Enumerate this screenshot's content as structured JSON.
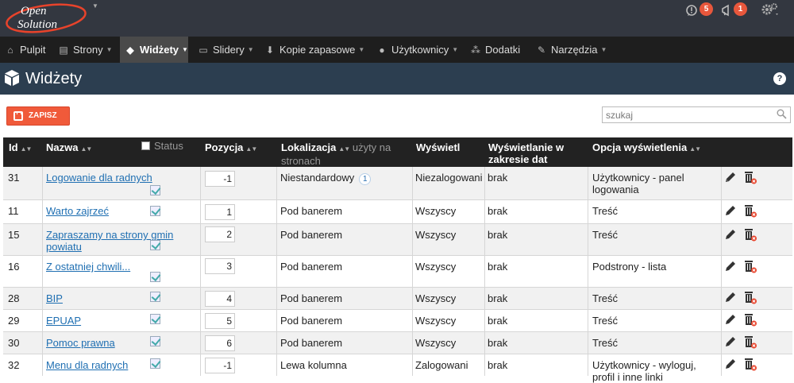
{
  "app": {
    "logo_line1": "Open",
    "logo_line2": "Solution",
    "notifications": {
      "messages": "5",
      "alerts": "1"
    }
  },
  "nav": {
    "items": [
      {
        "label": "Pulpit",
        "icon": "home-icon",
        "caret": false,
        "active": false
      },
      {
        "label": "Strony",
        "icon": "document-icon",
        "caret": true,
        "active": false
      },
      {
        "label": "Widżety",
        "icon": "cube-icon",
        "caret": true,
        "active": true
      },
      {
        "label": "Slidery",
        "icon": "slides-icon",
        "caret": true,
        "active": false
      },
      {
        "label": "Kopie zapasowe",
        "icon": "download-icon",
        "caret": true,
        "active": false
      },
      {
        "label": "Użytkownicy",
        "icon": "user-icon",
        "caret": true,
        "active": false
      },
      {
        "label": "Dodatki",
        "icon": "cubes-icon",
        "caret": false,
        "active": false
      },
      {
        "label": "Narzędzia",
        "icon": "wrench-icon",
        "caret": true,
        "active": false
      }
    ]
  },
  "page": {
    "title": "Widżety"
  },
  "toolbar": {
    "save_label": "ZAPISZ",
    "search_placeholder": "szukaj"
  },
  "table": {
    "headers": {
      "id": "Id",
      "name": "Nazwa",
      "status": "Status",
      "position": "Pozycja",
      "location": "Lokalizacja",
      "location_sub": "użyty na stronach",
      "display": "Wyświetl",
      "date_range": "Wyświetlanie w zakresie dat",
      "option": "Opcja wyświetlenia"
    },
    "rows": [
      {
        "id": "31",
        "name": "Logowanie dla radnych",
        "position": "-1",
        "location": "Niestandardowy",
        "location_count": "1",
        "display": "Niezalogowani",
        "date_range": "brak",
        "option": "Użytkownicy - panel logowania"
      },
      {
        "id": "11",
        "name": "Warto zajrzeć",
        "position": "1",
        "location": "Pod banerem",
        "display": "Wszyscy",
        "date_range": "brak",
        "option": "Treść"
      },
      {
        "id": "15",
        "name": "Zapraszamy na strony gmin powiatu",
        "position": "2",
        "location": "Pod banerem",
        "display": "Wszyscy",
        "date_range": "brak",
        "option": "Treść"
      },
      {
        "id": "16",
        "name": "Z ostatniej chwili...",
        "position": "3",
        "location": "Pod banerem",
        "display": "Wszyscy",
        "date_range": "brak",
        "option": "Podstrony - lista"
      },
      {
        "id": "28",
        "name": "BIP",
        "position": "4",
        "location": "Pod banerem",
        "display": "Wszyscy",
        "date_range": "brak",
        "option": "Treść"
      },
      {
        "id": "29",
        "name": "EPUAP",
        "position": "5",
        "location": "Pod banerem",
        "display": "Wszyscy",
        "date_range": "brak",
        "option": "Treść"
      },
      {
        "id": "30",
        "name": "Pomoc prawna",
        "position": "6",
        "location": "Pod banerem",
        "display": "Wszyscy",
        "date_range": "brak",
        "option": "Treść"
      },
      {
        "id": "32",
        "name": "Menu dla radnych",
        "position": "-1",
        "location": "Lewa kolumna",
        "display": "Zalogowani",
        "date_range": "brak",
        "option": "Użytkownicy - wyloguj, profil i inne linki"
      }
    ]
  },
  "colors": {
    "accent": "#f05a3a",
    "title_bar": "#2c3e50",
    "link": "#1f6fb2"
  }
}
